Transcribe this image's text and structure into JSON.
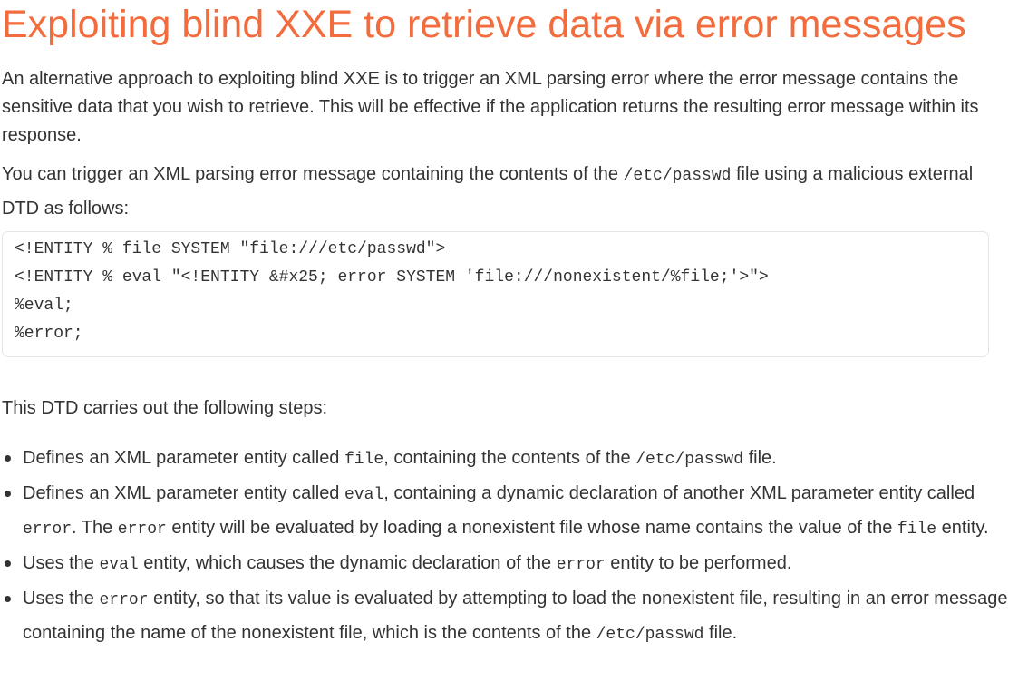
{
  "heading": "Exploiting blind XXE to retrieve data via error messages",
  "intro": "An alternative approach to exploiting blind XXE is to trigger an XML parsing error where the error message contains the sensitive data that you wish to retrieve. This will be effective if the application returns the resulting error message within its response.",
  "para2": {
    "before": "You can trigger an XML parsing error message containing the contents of the ",
    "code": "/etc/passwd",
    "after": " file using a malicious external DTD as follows:"
  },
  "code_block": [
    "<!ENTITY % file SYSTEM \"file:///etc/passwd\">",
    "<!ENTITY % eval \"<!ENTITY &#x25; error SYSTEM 'file:///nonexistent/%file;'>\">",
    "%eval;",
    "%error;"
  ],
  "steps_intro": "This DTD carries out the following steps:",
  "steps": [
    {
      "t1": "Defines an XML parameter entity called ",
      "c1": "file",
      "t2": ", containing the contents of the ",
      "c2": "/etc/passwd",
      "t3": " file."
    },
    {
      "t1": "Defines an XML parameter entity called ",
      "c1": "eval",
      "t2": ", containing a dynamic declaration of another XML parameter entity called ",
      "c2": "error",
      "t3": ". The ",
      "c3": "error",
      "t4": " entity will be evaluated by loading a nonexistent file whose name contains the value of the ",
      "c4": "file",
      "t5": " entity."
    },
    {
      "t1": "Uses the ",
      "c1": "eval",
      "t2": " entity, which causes the dynamic declaration of the ",
      "c2": "error",
      "t3": " entity to be performed."
    },
    {
      "t1": "Uses the ",
      "c1": "error",
      "t2": " entity, so that its value is evaluated by attempting to load the nonexistent file, resulting in an error message containing the name of the nonexistent file, which is the contents of the ",
      "c2": "/etc/passwd",
      "t3": " file."
    }
  ],
  "colors": {
    "heading": "#f36c3d",
    "text": "#333333",
    "code_border": "#e5e5e5"
  }
}
